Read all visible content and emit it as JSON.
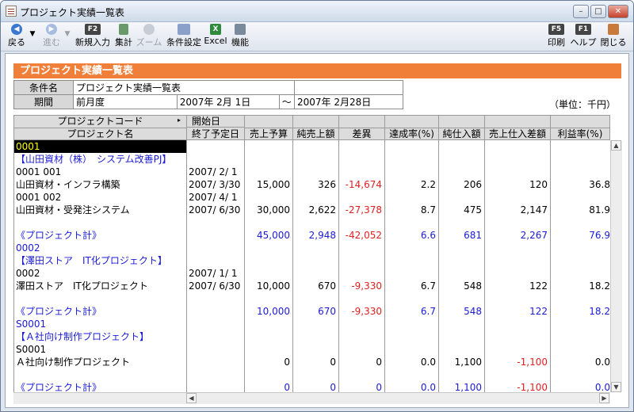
{
  "window": {
    "title": "プロジェクト実績一覧表"
  },
  "toolbar": {
    "back": "戻る",
    "forward": "進む",
    "new": "新規入力",
    "total": "集計",
    "zoom": "ズーム",
    "conditions": "条件設定",
    "excel": "Excel",
    "functions": "機能",
    "print": "印刷",
    "help": "ヘルプ",
    "close": "閉じる",
    "key_f2": "F2",
    "key_f5": "F5",
    "key_f1": "F1"
  },
  "report": {
    "heading": "プロジェクト実績一覧表",
    "cond_label": "条件名",
    "cond_value": "プロジェクト実績一覧表",
    "period_label": "期間",
    "period_value": "前月度",
    "date_from": "2007年 2月 1日",
    "tilde": "～",
    "date_to": "2007年 2月28日",
    "unit": "（単位：千円）"
  },
  "columns": {
    "code": "プロジェクトコード",
    "name": "プロジェクト名",
    "start": "開始日",
    "end": "終了予定日",
    "budget": "売上予算",
    "net_sales": "純売上額",
    "diff": "差異",
    "rate": "達成率(%)",
    "purchase": "純仕入額",
    "margin": "売上仕入差額",
    "profit_rate": "利益率(%)"
  },
  "rows": {
    "g1_code": "0001",
    "g1_name": "【山田資材（株）　システム改善PJ】",
    "r1_code": "0001 001",
    "r1_start": "2007/ 2/ 1",
    "r1_name": "山田資材・インフラ構築",
    "r1_end": "2007/ 3/30",
    "r1_budget": "15,000",
    "r1_sales": "326",
    "r1_diff": "-14,674",
    "r1_rate": "2.2",
    "r1_purchase": "206",
    "r1_margin": "120",
    "r1_profit": "36.8",
    "r2_code": "0001 002",
    "r2_start": "2007/ 4/ 1",
    "r2_name": "山田資材・受発注システム",
    "r2_end": "2007/ 6/30",
    "r2_budget": "30,000",
    "r2_sales": "2,622",
    "r2_diff": "-27,378",
    "r2_rate": "8.7",
    "r2_purchase": "475",
    "r2_margin": "2,147",
    "r2_profit": "81.9",
    "t1_name": "《プロジェクト計》",
    "t1_budget": "45,000",
    "t1_sales": "2,948",
    "t1_diff": "-42,052",
    "t1_rate": "6.6",
    "t1_purchase": "681",
    "t1_margin": "2,267",
    "t1_profit": "76.9",
    "g2_code": "0002",
    "g2_name": "【澤田ストア　IT化プロジェクト】",
    "r3_code": "0002",
    "r3_start": "2007/ 1/ 1",
    "r3_name": "澤田ストア　IT化プロジェクト",
    "r3_end": "2007/ 6/30",
    "r3_budget": "10,000",
    "r3_sales": "670",
    "r3_diff": "-9,330",
    "r3_rate": "6.7",
    "r3_purchase": "548",
    "r3_margin": "122",
    "r3_profit": "18.2",
    "t2_name": "《プロジェクト計》",
    "t2_budget": "10,000",
    "t2_sales": "670",
    "t2_diff": "-9,330",
    "t2_rate": "6.7",
    "t2_purchase": "548",
    "t2_margin": "122",
    "t2_profit": "18.2",
    "g3_code": "S0001",
    "g3_name": "【Ａ社向け制作プロジェクト】",
    "r4_code": "S0001",
    "r4_name": "Ａ社向け制作プロジェクト",
    "r4_budget": "0",
    "r4_sales": "0",
    "r4_diff": "0",
    "r4_rate": "0.0",
    "r4_purchase": "1,100",
    "r4_margin": "-1,100",
    "r4_profit": "0.0",
    "t3_name": "《プロジェクト計》",
    "t3_budget": "0",
    "t3_sales": "0",
    "t3_diff": "0",
    "t3_rate": "0.0",
    "t3_purchase": "1,100",
    "t3_margin": "-1,100",
    "t3_profit": "0.0"
  }
}
